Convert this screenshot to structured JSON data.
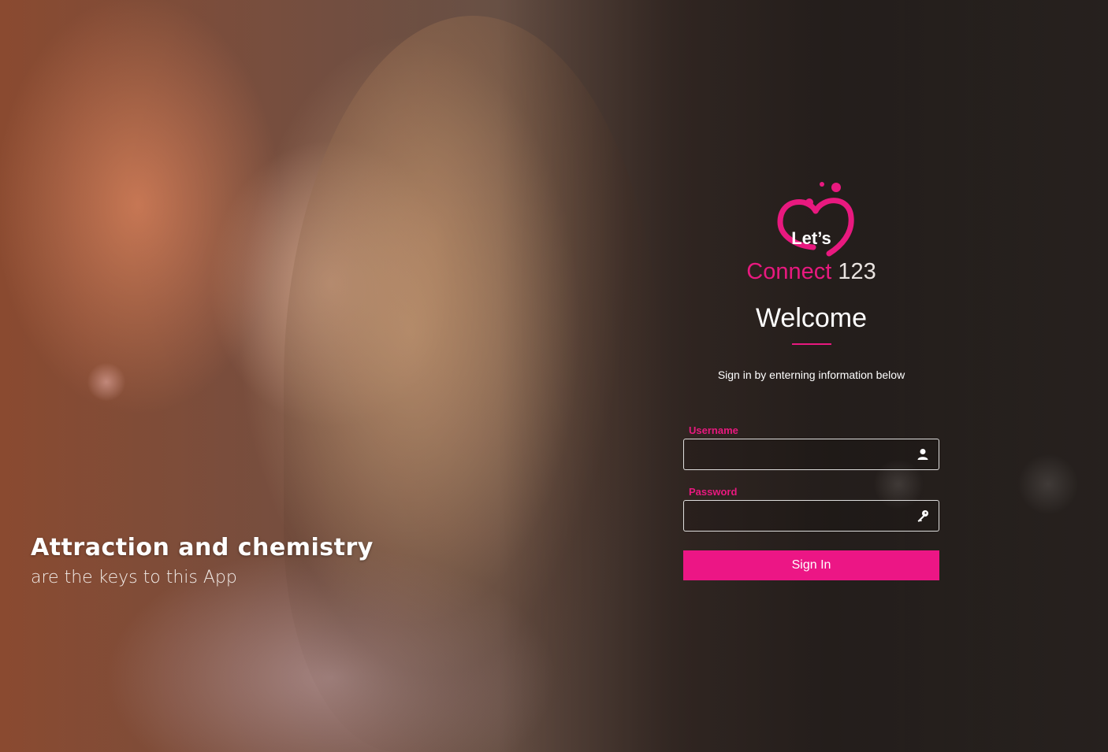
{
  "hero": {
    "title": "Attraction and chemistry",
    "subtitle": "are the keys to this App"
  },
  "logo": {
    "lets": "Let’s",
    "connect": "Connect",
    "number": "123"
  },
  "login": {
    "welcome": "Welcome",
    "instructions": "Sign in by enterning information below",
    "username_label": "Username",
    "username_value": "",
    "password_label": "Password",
    "password_value": "",
    "signin_label": "Sign In"
  },
  "colors": {
    "accent": "#e8197f",
    "button": "#ec1685"
  },
  "icons": {
    "username": "user-icon",
    "password": "key-icon"
  }
}
